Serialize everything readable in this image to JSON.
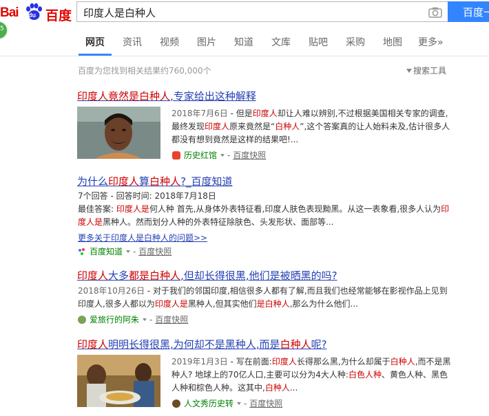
{
  "header": {
    "logo_bai": "Bai",
    "logo_du": "du",
    "logo_cn": "百度",
    "query": "印度人是白种人",
    "search_button": "百度一下",
    "side_badge": "5"
  },
  "tabs": [
    {
      "label": "网页",
      "active": true
    },
    {
      "label": "资讯"
    },
    {
      "label": "视频"
    },
    {
      "label": "图片"
    },
    {
      "label": "知道"
    },
    {
      "label": "文库"
    },
    {
      "label": "贴吧"
    },
    {
      "label": "采购"
    },
    {
      "label": "地图"
    },
    {
      "label": "更多»"
    }
  ],
  "stats": "百度为您找到相关结果约760,000个",
  "tools_label": "搜索工具",
  "results": [
    {
      "title_parts": [
        "印度人",
        "竟然是",
        "白种人",
        ",专家给出这种解释"
      ],
      "date": "2018年7月6日",
      "snippet_parts": [
        " - 但是",
        "印度人",
        "却让人难以辨别,不过根据美国相关专家的调查,最终发现",
        "印度人",
        "原来竟然是“",
        "白种人",
        "”,这个答案真的让人始料未及,估计很多人都没有想到竟然是这样的结果吧!..."
      ],
      "source": "历史红馆",
      "snapshot": "百度快照",
      "dash": "-"
    },
    {
      "title_parts": [
        "为什么",
        "印度人",
        "算",
        "白种人",
        "?_百度知道"
      ],
      "meta": "7个回答 - 回答时间: 2018年7月18日",
      "snippet_parts": [
        "最佳答案: ",
        "印度人是",
        "何人种 首先,从身体外表特征看,印度人肤色表现黝黑。从这一表象看,很多人认为",
        "印度人是",
        "黑种人。然而划分人种的外表特征除肤色、头发形状、面部等..."
      ],
      "more": "更多关于印度人是白种人的问题>>",
      "source": "百度知道",
      "snapshot": "百度快照",
      "dash": "-"
    },
    {
      "title_parts": [
        "印度人",
        "大多",
        "都是",
        "白种人",
        ",但却长得很黑,他们是被晒黑的吗?"
      ],
      "date": "2018年10月26日",
      "snippet_parts": [
        " - 对于我们的邻国印度,相信很多人都有了解,而且我们也经常能够在影视作品上见到印度人,很多人都以为",
        "印度人是",
        "黑种人,但其实他们",
        "是白种人",
        ",那么为什么他们..."
      ],
      "source": "爱旅行的阿朱",
      "snapshot": "百度快照",
      "dash": "-"
    },
    {
      "title_parts": [
        "印度人",
        "明明长得很黑,为何却不是黑种人,而是",
        "白种人",
        "呢?"
      ],
      "date": "2019年1月3日",
      "snippet_parts": [
        " - 写在前面:",
        "印度人",
        "长得那么黑,为什么却属于",
        "白种人",
        ",而不是黑种人? 地球上的70亿人口,主要可以分为4大人种:",
        "白色人种",
        "、黄色人种、黑色人种和棕色人种。这其中,",
        "白种人",
        "..."
      ],
      "source": "人文秀历史转",
      "snapshot": "百度快照",
      "dash": "-"
    }
  ]
}
